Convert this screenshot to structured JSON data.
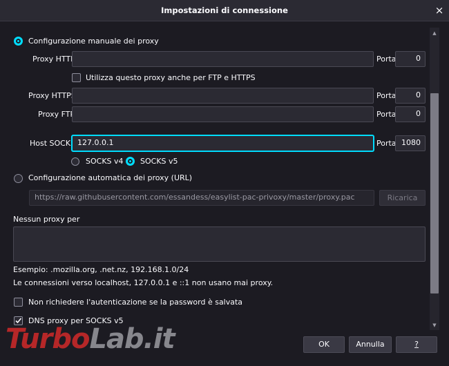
{
  "dialog": {
    "title": "Impostazioni di connessione",
    "close_glyph": "×"
  },
  "manual": {
    "label": "Configurazione manuale dei proxy",
    "http_label": "Proxy HTTP",
    "http_value": "",
    "port_label": "Porta",
    "http_port": "0",
    "also_ftp_https_label": "Utilizza questo proxy anche per FTP e HTTPS",
    "https_label": "Proxy HTTPS",
    "https_value": "",
    "https_port": "0",
    "ftp_label": "Proxy FTP",
    "ftp_value": "",
    "ftp_port": "0",
    "socks_label": "Host SOCKS",
    "socks_value": "127.0.0.1",
    "socks_port": "1080",
    "socks_v4_label": "SOCKS v4",
    "socks_v5_label": "SOCKS v5"
  },
  "auto": {
    "label": "Configurazione automatica dei proxy (URL)",
    "url_value": "https://raw.githubusercontent.com/essandess/easylist-pac-privoxy/master/proxy.pac",
    "reload_label": "Ricarica"
  },
  "no_proxy": {
    "label": "Nessun proxy per",
    "value": "",
    "example": "Esempio: .mozilla.org, .net.nz, 192.168.1.0/24",
    "localhost_note": "Le connessioni verso localhost, 127.0.0.1 e ::1 non usano mai proxy."
  },
  "options": {
    "no_auth_label": "Non richiedere l'autenticazione se la password è salvata",
    "dns_socks_label": "DNS proxy per SOCKS v5"
  },
  "footer": {
    "ok_label": "OK",
    "cancel_label": "Annulla",
    "help_label": "?"
  },
  "watermark": {
    "part1": "Turbo",
    "part2": "Lab.it"
  },
  "colors": {
    "accent": "#00ddff",
    "bg": "#1c1b22",
    "field_bg": "#2b2a33"
  }
}
